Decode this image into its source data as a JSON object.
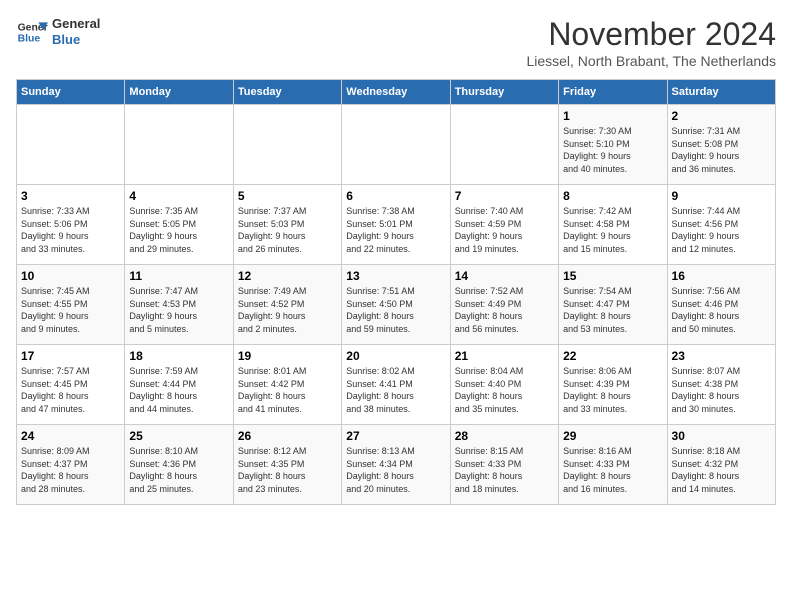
{
  "logo": {
    "line1": "General",
    "line2": "Blue"
  },
  "title": "November 2024",
  "subtitle": "Liessel, North Brabant, The Netherlands",
  "days_header": [
    "Sunday",
    "Monday",
    "Tuesday",
    "Wednesday",
    "Thursday",
    "Friday",
    "Saturday"
  ],
  "weeks": [
    [
      {
        "day": "",
        "info": ""
      },
      {
        "day": "",
        "info": ""
      },
      {
        "day": "",
        "info": ""
      },
      {
        "day": "",
        "info": ""
      },
      {
        "day": "",
        "info": ""
      },
      {
        "day": "1",
        "info": "Sunrise: 7:30 AM\nSunset: 5:10 PM\nDaylight: 9 hours\nand 40 minutes."
      },
      {
        "day": "2",
        "info": "Sunrise: 7:31 AM\nSunset: 5:08 PM\nDaylight: 9 hours\nand 36 minutes."
      }
    ],
    [
      {
        "day": "3",
        "info": "Sunrise: 7:33 AM\nSunset: 5:06 PM\nDaylight: 9 hours\nand 33 minutes."
      },
      {
        "day": "4",
        "info": "Sunrise: 7:35 AM\nSunset: 5:05 PM\nDaylight: 9 hours\nand 29 minutes."
      },
      {
        "day": "5",
        "info": "Sunrise: 7:37 AM\nSunset: 5:03 PM\nDaylight: 9 hours\nand 26 minutes."
      },
      {
        "day": "6",
        "info": "Sunrise: 7:38 AM\nSunset: 5:01 PM\nDaylight: 9 hours\nand 22 minutes."
      },
      {
        "day": "7",
        "info": "Sunrise: 7:40 AM\nSunset: 4:59 PM\nDaylight: 9 hours\nand 19 minutes."
      },
      {
        "day": "8",
        "info": "Sunrise: 7:42 AM\nSunset: 4:58 PM\nDaylight: 9 hours\nand 15 minutes."
      },
      {
        "day": "9",
        "info": "Sunrise: 7:44 AM\nSunset: 4:56 PM\nDaylight: 9 hours\nand 12 minutes."
      }
    ],
    [
      {
        "day": "10",
        "info": "Sunrise: 7:45 AM\nSunset: 4:55 PM\nDaylight: 9 hours\nand 9 minutes."
      },
      {
        "day": "11",
        "info": "Sunrise: 7:47 AM\nSunset: 4:53 PM\nDaylight: 9 hours\nand 5 minutes."
      },
      {
        "day": "12",
        "info": "Sunrise: 7:49 AM\nSunset: 4:52 PM\nDaylight: 9 hours\nand 2 minutes."
      },
      {
        "day": "13",
        "info": "Sunrise: 7:51 AM\nSunset: 4:50 PM\nDaylight: 8 hours\nand 59 minutes."
      },
      {
        "day": "14",
        "info": "Sunrise: 7:52 AM\nSunset: 4:49 PM\nDaylight: 8 hours\nand 56 minutes."
      },
      {
        "day": "15",
        "info": "Sunrise: 7:54 AM\nSunset: 4:47 PM\nDaylight: 8 hours\nand 53 minutes."
      },
      {
        "day": "16",
        "info": "Sunrise: 7:56 AM\nSunset: 4:46 PM\nDaylight: 8 hours\nand 50 minutes."
      }
    ],
    [
      {
        "day": "17",
        "info": "Sunrise: 7:57 AM\nSunset: 4:45 PM\nDaylight: 8 hours\nand 47 minutes."
      },
      {
        "day": "18",
        "info": "Sunrise: 7:59 AM\nSunset: 4:44 PM\nDaylight: 8 hours\nand 44 minutes."
      },
      {
        "day": "19",
        "info": "Sunrise: 8:01 AM\nSunset: 4:42 PM\nDaylight: 8 hours\nand 41 minutes."
      },
      {
        "day": "20",
        "info": "Sunrise: 8:02 AM\nSunset: 4:41 PM\nDaylight: 8 hours\nand 38 minutes."
      },
      {
        "day": "21",
        "info": "Sunrise: 8:04 AM\nSunset: 4:40 PM\nDaylight: 8 hours\nand 35 minutes."
      },
      {
        "day": "22",
        "info": "Sunrise: 8:06 AM\nSunset: 4:39 PM\nDaylight: 8 hours\nand 33 minutes."
      },
      {
        "day": "23",
        "info": "Sunrise: 8:07 AM\nSunset: 4:38 PM\nDaylight: 8 hours\nand 30 minutes."
      }
    ],
    [
      {
        "day": "24",
        "info": "Sunrise: 8:09 AM\nSunset: 4:37 PM\nDaylight: 8 hours\nand 28 minutes."
      },
      {
        "day": "25",
        "info": "Sunrise: 8:10 AM\nSunset: 4:36 PM\nDaylight: 8 hours\nand 25 minutes."
      },
      {
        "day": "26",
        "info": "Sunrise: 8:12 AM\nSunset: 4:35 PM\nDaylight: 8 hours\nand 23 minutes."
      },
      {
        "day": "27",
        "info": "Sunrise: 8:13 AM\nSunset: 4:34 PM\nDaylight: 8 hours\nand 20 minutes."
      },
      {
        "day": "28",
        "info": "Sunrise: 8:15 AM\nSunset: 4:33 PM\nDaylight: 8 hours\nand 18 minutes."
      },
      {
        "day": "29",
        "info": "Sunrise: 8:16 AM\nSunset: 4:33 PM\nDaylight: 8 hours\nand 16 minutes."
      },
      {
        "day": "30",
        "info": "Sunrise: 8:18 AM\nSunset: 4:32 PM\nDaylight: 8 hours\nand 14 minutes."
      }
    ]
  ]
}
